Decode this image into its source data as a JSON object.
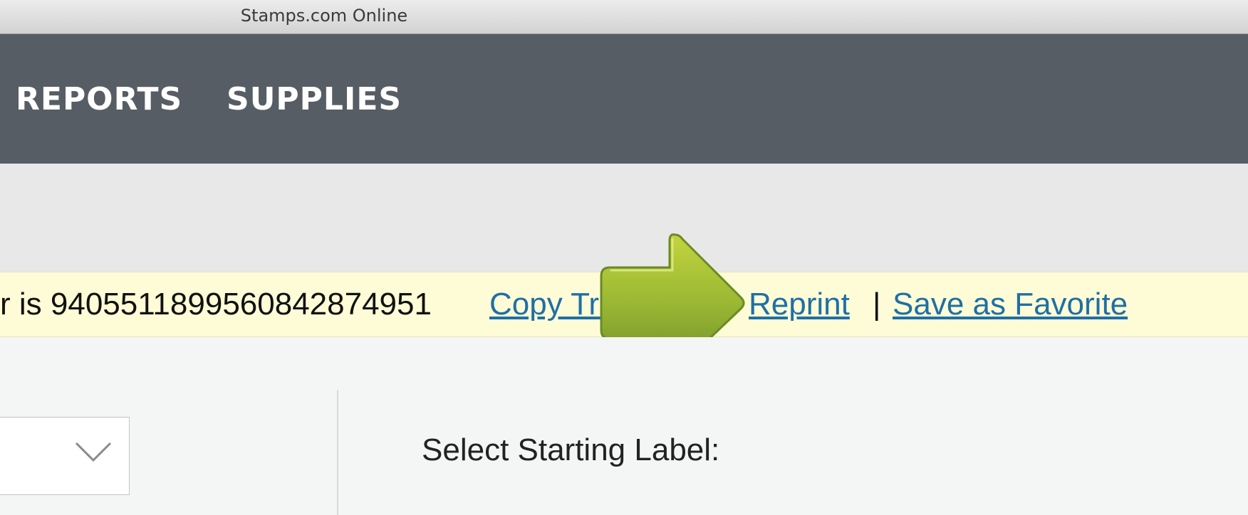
{
  "window": {
    "title": "Stamps.com Online"
  },
  "nav": {
    "items": [
      {
        "label": "REPORTS"
      },
      {
        "label": "SUPPLIES"
      }
    ]
  },
  "notice": {
    "tracking_text": "r is 9405511899560842874951",
    "copy_link": "Copy Tracking #",
    "reprint_link": "Reprint",
    "separator": "|",
    "favorite_link": "Save as Favorite",
    "link_color": "#1f6fa5",
    "background_color": "#fdfcd7"
  },
  "overlay": {
    "icon": "green-arrow-right-icon",
    "color": "#9ab833"
  },
  "content": {
    "select_icon": "chevron-down-icon",
    "starting_label": "Select Starting Label:"
  },
  "colors": {
    "navbar": "#565d64",
    "band": "#e8e8e8",
    "content_bg": "#f4f5f5"
  }
}
